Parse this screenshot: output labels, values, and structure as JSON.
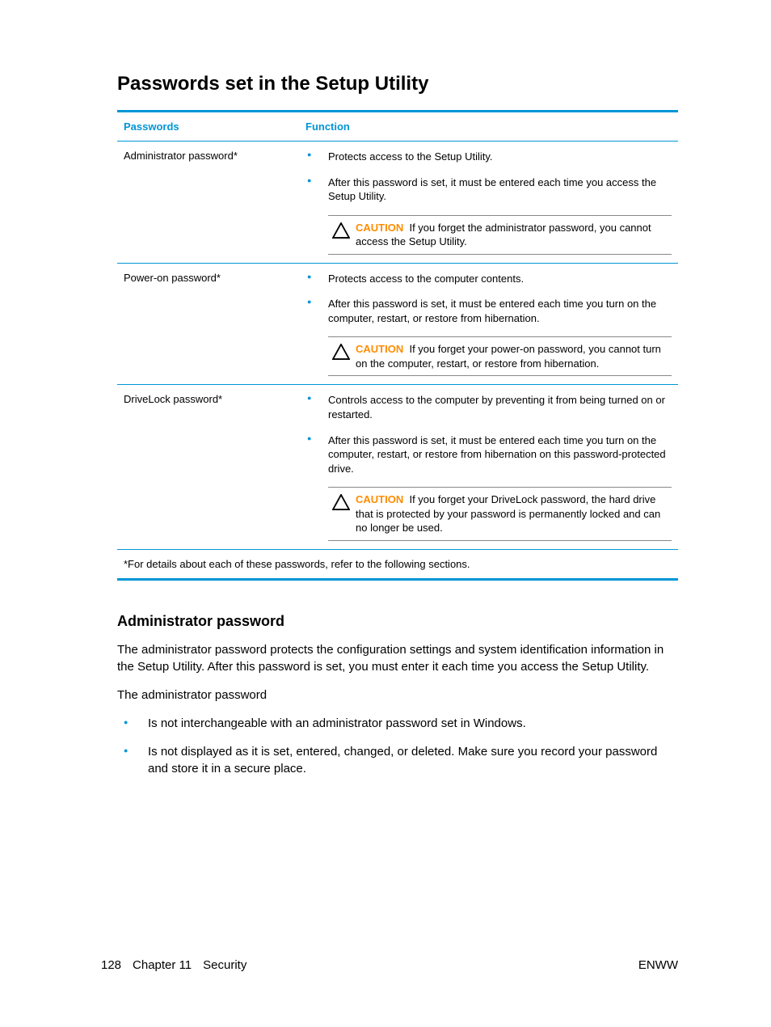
{
  "title": "Passwords set in the Setup Utility",
  "table": {
    "headers": {
      "passwords": "Passwords",
      "function": "Function"
    },
    "rows": [
      {
        "name": "Administrator password*",
        "bullets": [
          "Protects access to the Setup Utility.",
          "After this password is set, it must be entered each time you access the Setup Utility."
        ],
        "caution_label": "CAUTION",
        "caution_text": "If you forget the administrator password, you cannot access the Setup Utility."
      },
      {
        "name": "Power-on password*",
        "bullets": [
          "Protects access to the computer contents.",
          "After this password is set, it must be entered each time you turn on the computer, restart, or restore from hibernation."
        ],
        "caution_label": "CAUTION",
        "caution_text": "If you forget your power-on password, you cannot turn on the computer, restart, or restore from hibernation."
      },
      {
        "name": "DriveLock password*",
        "bullets": [
          "Controls access to the computer by preventing it from being turned on or restarted.",
          "After this password is set, it must be entered each time you turn on the computer, restart, or restore from hibernation on this password-protected drive."
        ],
        "caution_label": "CAUTION",
        "caution_text": "If you forget your DriveLock password, the hard drive that is protected by your password is permanently locked and can no longer be used."
      }
    ],
    "footnote": "*For details about each of these passwords, refer to the following sections."
  },
  "section": {
    "heading": "Administrator password",
    "p1": "The administrator password protects the configuration settings and system identification information in the Setup Utility. After this password is set, you must enter it each time you access the Setup Utility.",
    "p2": "The administrator password",
    "bullets": [
      "Is not interchangeable with an administrator password set in Windows.",
      "Is not displayed as it is set, entered, changed, or deleted. Make sure you record your password and store it in a secure place."
    ]
  },
  "footer": {
    "page": "128",
    "chapter": "Chapter 11",
    "section": "Security",
    "right": "ENWW"
  }
}
